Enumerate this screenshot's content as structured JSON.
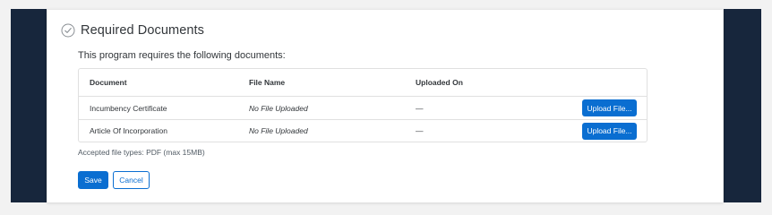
{
  "section": {
    "title": "Required Documents",
    "status_icon": "circle-check-icon",
    "intro": "This program requires the following documents:"
  },
  "table": {
    "columns": [
      "Document",
      "File Name",
      "Uploaded On",
      ""
    ],
    "rows": [
      {
        "document": "Incumbency Certificate",
        "file_name": "No File Uploaded",
        "uploaded_on": "—",
        "action_label": "Upload File..."
      },
      {
        "document": "Article Of Incorporation",
        "file_name": "No File Uploaded",
        "uploaded_on": "—",
        "action_label": "Upload File..."
      }
    ]
  },
  "accepted_types": "Accepted file types: PDF (max 15MB)",
  "actions": {
    "save_label": "Save",
    "cancel_label": "Cancel"
  },
  "colors": {
    "accent": "#0a6ed1",
    "sidebar": "#17263c",
    "background": "#f2f2f2"
  }
}
